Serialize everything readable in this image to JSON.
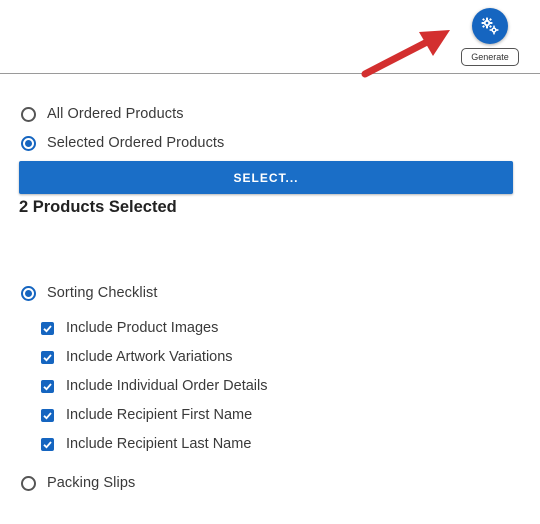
{
  "toolbar": {
    "generate_tooltip": "Generate",
    "generate_icon": "gears-icon",
    "accent_color": "#1565c0"
  },
  "annotation": {
    "arrow_color": "#d32f2f",
    "arrow_icon": "red-arrow-pointer"
  },
  "product_scope": {
    "options": [
      {
        "label": "All Ordered Products",
        "selected": false
      },
      {
        "label": "Selected Ordered Products",
        "selected": true
      }
    ],
    "select_button_label": "SELECT...",
    "selected_count_text": "2 Products Selected"
  },
  "report_type": {
    "sorting_checklist_label": "Sorting Checklist",
    "sorting_checklist_selected": true,
    "checklist_options": [
      {
        "label": "Include Product Images",
        "checked": true
      },
      {
        "label": "Include Artwork Variations",
        "checked": true
      },
      {
        "label": "Include Individual Order Details",
        "checked": true
      },
      {
        "label": "Include Recipient First Name",
        "checked": true
      },
      {
        "label": "Include Recipient Last Name",
        "checked": true
      }
    ],
    "packing_slips_label": "Packing Slips",
    "packing_slips_selected": false
  }
}
